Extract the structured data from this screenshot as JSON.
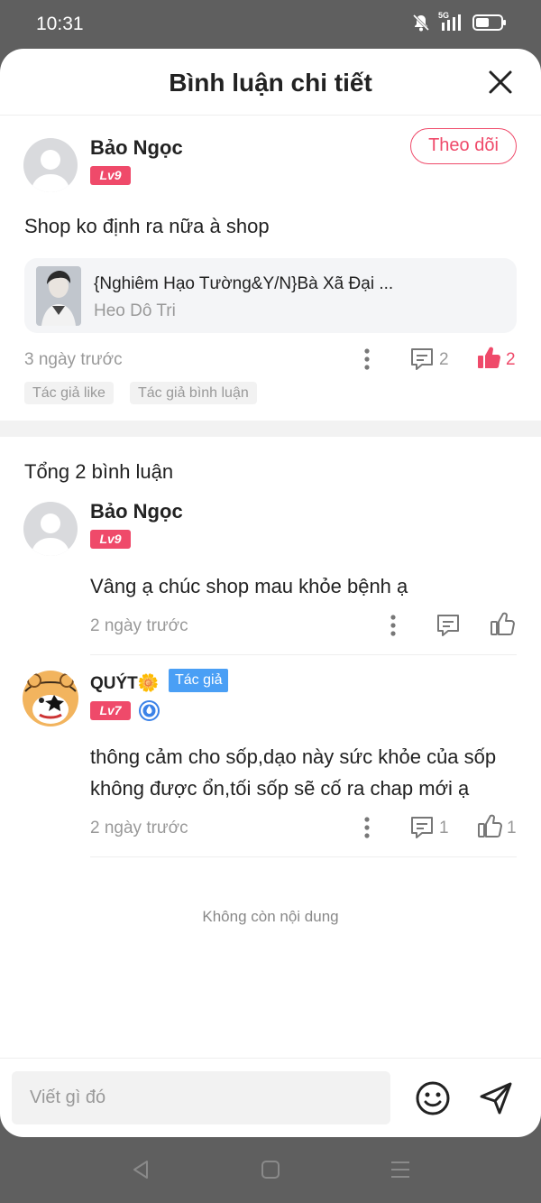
{
  "status_bar": {
    "time": "10:31",
    "network": "5G"
  },
  "header": {
    "title": "Bình luận chi tiết"
  },
  "main_comment": {
    "user_name": "Bảo Ngọc",
    "level": "Lv9",
    "follow_label": "Theo dõi",
    "text": "Shop ko định ra nữa à shop",
    "story": {
      "title": "{Nghiêm Hạo Tường&Y/N}Bà Xã Đại ...",
      "author": "Heo Dô Tri"
    },
    "time": "3 ngày trước",
    "reply_count": "2",
    "like_count": "2",
    "tags": [
      "Tác giả like",
      "Tác giả bình luận"
    ]
  },
  "replies_section": {
    "total_label": "Tổng 2 bình luận",
    "replies": [
      {
        "user_name": "Bảo Ngọc",
        "level": "Lv9",
        "text": "Vâng ạ chúc shop mau khỏe bệnh ạ",
        "time": "2 ngày trước",
        "reply_count": "",
        "like_count": ""
      },
      {
        "user_name": "QUÝT🌼",
        "author_badge": "Tác giả",
        "level": "Lv7",
        "text_lines": [
          "thông cảm cho sốp,dạo này sức khỏe của sốp",
          "không được ổn,tối sốp sẽ cố ra chap mới ạ"
        ],
        "time": "2 ngày trước",
        "reply_count": "1",
        "like_count": "1"
      }
    ],
    "end_text": "Không còn nội dung"
  },
  "input_bar": {
    "placeholder": "Viết gì đó"
  },
  "colors": {
    "accent": "#ef4a6a",
    "author_badge": "#4a9ff5",
    "muted": "#999999"
  },
  "icons": [
    "mute-icon",
    "signal-icon",
    "battery-icon",
    "close-icon",
    "more-icon",
    "comment-icon",
    "thumb-up-icon",
    "emoji-icon",
    "send-icon",
    "back-icon",
    "home-icon",
    "menu-icon"
  ]
}
